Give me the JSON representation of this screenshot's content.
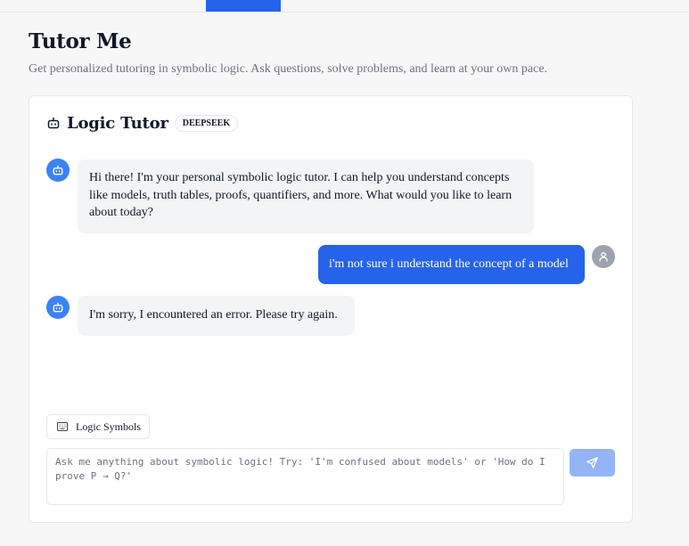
{
  "page": {
    "title": "Tutor Me",
    "subtitle": "Get personalized tutoring in symbolic logic. Ask questions, solve problems, and learn at your own pace."
  },
  "chat": {
    "title": "Logic Tutor",
    "badge": "DEEPSEEK",
    "messages": [
      {
        "role": "bot",
        "icon": "bot-icon",
        "text": "Hi there! I'm your personal symbolic logic tutor. I can help you understand concepts like models, truth tables, proofs, quantifiers, and more. What would you like to learn about today?"
      },
      {
        "role": "user",
        "icon": "user-icon",
        "text": "i'm not sure i understand the concept of a model"
      },
      {
        "role": "bot",
        "icon": "bot-icon",
        "text": "I'm sorry, I encountered an error. Please try again."
      }
    ],
    "symbols_button": "Logic Symbols",
    "input": {
      "value": "",
      "placeholder": "Ask me anything about symbolic logic! Try: 'I'm confused about models' or 'How do I prove P → Q?'"
    },
    "send_icon": "send-icon"
  },
  "colors": {
    "accent": "#2563eb",
    "bot_avatar": "#3b82f6",
    "user_avatar": "#9ca3af",
    "bot_bubble": "#f3f4f6",
    "send_disabled": "#93b4f5"
  }
}
